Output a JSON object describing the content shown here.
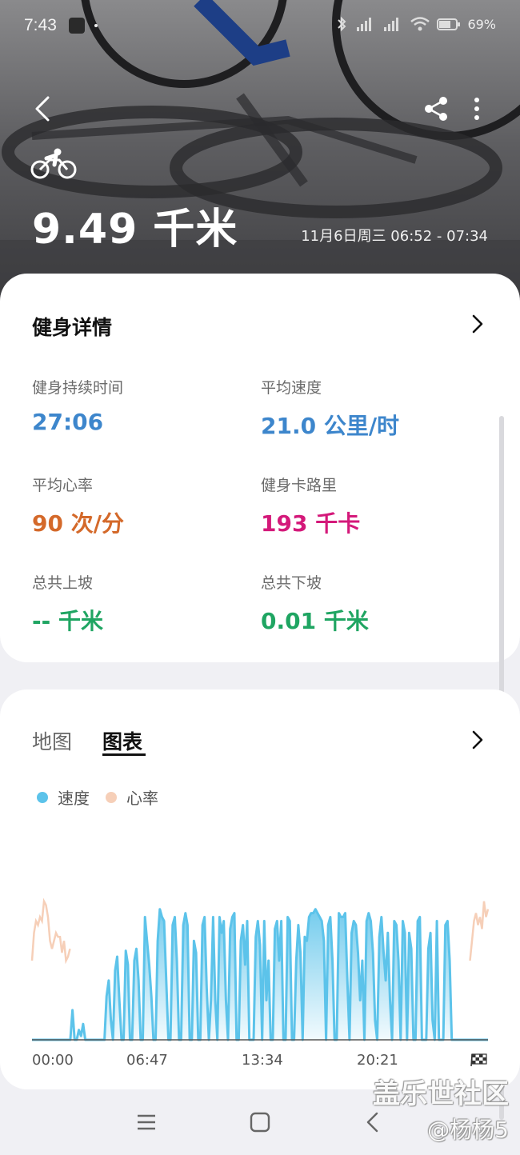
{
  "status_bar": {
    "time": "7:43",
    "battery": "69%"
  },
  "header": {
    "activity_icon": "cycling-icon",
    "distance": "9.49 千米",
    "time_range": "11月6日周三 06:52 - 07:34"
  },
  "details": {
    "title": "健身详情",
    "stats": [
      {
        "label": "健身持续时间",
        "value": "27:06",
        "color": "#3d86cc"
      },
      {
        "label": "平均速度",
        "value": "21.0 公里/时",
        "color": "#3d86cc"
      },
      {
        "label": "平均心率",
        "value": "90 次/分",
        "color": "#d4692a"
      },
      {
        "label": "健身卡路里",
        "value": "193 千卡",
        "color": "#d4197a"
      },
      {
        "label": "总共上坡",
        "value": "-- 千米",
        "color": "#1fa562"
      },
      {
        "label": "总共下坡",
        "value": "0.01 千米",
        "color": "#1fa562"
      }
    ]
  },
  "chart_section": {
    "tabs": [
      "地图",
      "图表"
    ],
    "selected_tab": "图表"
  },
  "chart_data": {
    "type": "area",
    "x_tick_labels": [
      "00:00",
      "06:47",
      "13:34",
      "20:21"
    ],
    "xlim": [
      0,
      27.1
    ],
    "series": [
      {
        "name": "速度",
        "color": "#5cc3ea",
        "values": [
          0,
          0,
          0,
          0,
          0,
          0,
          0,
          0,
          0,
          0,
          0,
          0,
          0,
          0,
          0,
          0,
          0,
          0,
          0,
          15,
          0,
          0,
          5,
          2,
          8,
          0,
          0,
          0,
          0,
          0,
          0,
          0,
          0,
          0,
          0,
          22,
          30,
          10,
          0,
          35,
          42,
          20,
          0,
          0,
          45,
          38,
          0,
          0,
          40,
          46,
          30,
          0,
          0,
          62,
          50,
          38,
          22,
          0,
          0,
          50,
          66,
          62,
          60,
          30,
          0,
          0,
          58,
          62,
          40,
          0,
          0,
          58,
          64,
          58,
          0,
          0,
          50,
          44,
          0,
          0,
          58,
          62,
          26,
          0,
          20,
          62,
          20,
          0,
          62,
          54,
          60,
          20,
          0,
          56,
          62,
          64,
          0,
          0,
          50,
          58,
          38,
          60,
          0,
          0,
          0,
          52,
          60,
          48,
          0,
          60,
          20,
          40,
          0,
          0,
          56,
          60,
          40,
          60,
          0,
          0,
          62,
          60,
          0,
          0,
          40,
          58,
          44,
          0,
          52,
          50,
          62,
          64,
          64,
          66,
          64,
          62,
          60,
          50,
          0,
          58,
          62,
          40,
          0,
          0,
          64,
          62,
          62,
          64,
          30,
          0,
          54,
          60,
          58,
          44,
          20,
          40,
          0,
          60,
          64,
          60,
          44,
          10,
          0,
          52,
          62,
          44,
          30,
          54,
          20,
          0,
          60,
          58,
          40,
          0,
          60,
          54,
          0,
          54,
          46,
          0,
          0,
          60,
          62,
          0,
          0,
          0,
          46,
          54,
          10,
          0,
          60,
          0,
          0,
          0,
          58,
          60,
          40,
          0,
          0,
          0,
          0,
          0,
          0,
          0,
          0,
          0,
          0,
          0,
          0,
          0,
          0,
          0,
          0,
          0,
          0
        ]
      },
      {
        "name": "心率",
        "color": "#f6cfb8",
        "values": [
          40,
          54,
          60,
          58,
          62,
          60,
          70,
          68,
          62,
          50,
          46,
          50,
          54,
          52,
          52,
          44,
          50,
          40,
          42,
          46,
          0,
          0,
          0,
          0,
          0,
          0,
          0,
          0,
          0,
          0,
          0,
          0,
          0,
          0,
          0,
          0,
          0,
          0,
          0,
          0,
          0,
          0,
          0,
          0,
          0,
          0,
          0,
          0,
          0,
          0,
          0,
          0,
          0,
          0,
          0,
          0,
          0,
          0,
          0,
          0,
          0,
          0,
          0,
          0,
          0,
          0,
          0,
          0,
          0,
          0,
          0,
          0,
          0,
          0,
          0,
          0,
          0,
          0,
          0,
          0,
          0,
          0,
          0,
          0,
          0,
          0,
          0,
          0,
          0,
          0,
          0,
          0,
          0,
          0,
          0,
          0,
          0,
          0,
          0,
          0,
          0,
          0,
          0,
          0,
          0,
          0,
          0,
          0,
          0,
          0,
          0,
          0,
          0,
          0,
          0,
          0,
          0,
          0,
          0,
          0,
          0,
          0,
          0,
          0,
          0,
          0,
          0,
          0,
          0,
          0,
          0,
          0,
          0,
          0,
          0,
          0,
          0,
          0,
          0,
          0,
          0,
          0,
          0,
          0,
          0,
          0,
          0,
          0,
          0,
          0,
          0,
          0,
          0,
          0,
          0,
          0,
          0,
          0,
          0,
          0,
          0,
          0,
          0,
          0,
          0,
          0,
          0,
          0,
          0,
          0,
          0,
          0,
          0,
          0,
          0,
          0,
          0,
          0,
          0,
          0,
          0,
          0,
          0,
          0,
          0,
          0,
          0,
          0,
          0,
          0,
          0,
          0,
          0,
          0,
          0,
          0,
          0,
          0,
          0,
          0,
          0,
          0,
          0,
          0,
          0,
          0,
          0,
          0,
          0,
          0,
          0,
          0,
          0,
          0,
          0,
          0,
          0,
          0,
          0,
          40,
          50,
          60,
          64,
          58,
          62,
          56,
          70,
          62,
          66
        ]
      }
    ],
    "ylim": [
      0,
      80
    ],
    "grid": false,
    "legend_position": "top-left"
  },
  "watermark": {
    "site": "盖乐世社区",
    "handle": "@杨杨5"
  },
  "icons": {
    "back": "back-arrow-icon",
    "share": "share-icon",
    "more": "more-vert-icon",
    "chevron": "chevron-right-icon",
    "finish": "finish-flag-icon",
    "nav_recent": "recent-apps-icon",
    "nav_home": "home-icon",
    "nav_back": "nav-back-icon"
  }
}
